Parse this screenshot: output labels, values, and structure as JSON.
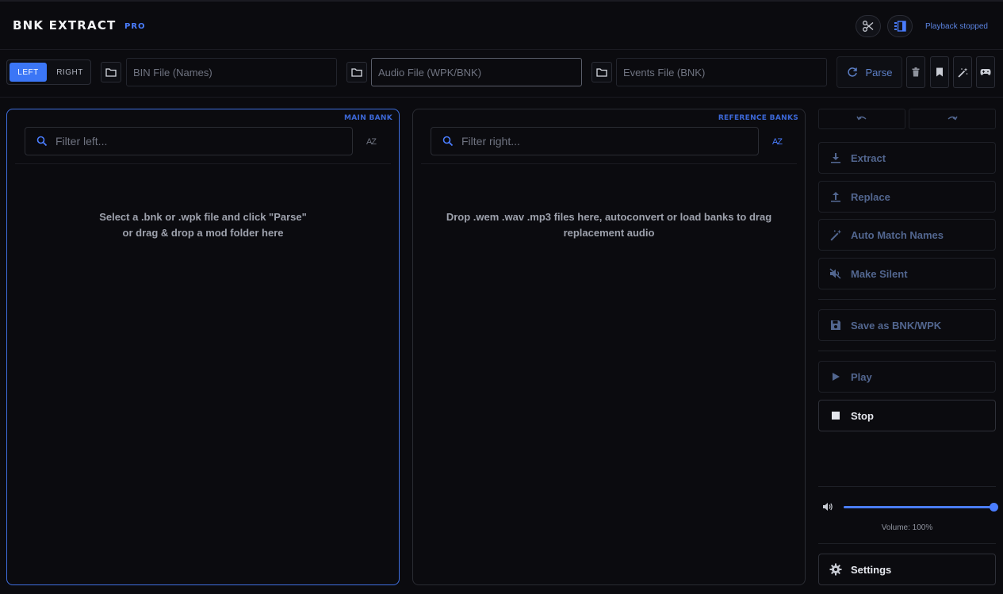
{
  "header": {
    "title": "BNK EXTRACT",
    "badge": "PRO",
    "playback_status": "Playback stopped",
    "icons": [
      "scissors-icon",
      "panel-layout-icon"
    ]
  },
  "toolbar": {
    "side_left": "LEFT",
    "side_right": "RIGHT",
    "bin_placeholder": "BIN File (Names)",
    "audio_placeholder": "Audio File (WPK/BNK)",
    "events_placeholder": "Events File (BNK)",
    "parse_label": "Parse",
    "tool_icons": [
      "trash-icon",
      "bookmark-icon",
      "magic-wand-icon",
      "gamepad-icon"
    ]
  },
  "left_panel": {
    "tag": "MAIN BANK",
    "filter_placeholder": "Filter left...",
    "sort_label": "AZ",
    "message_line1": "Select a .bnk or .wpk file and click \"Parse\"",
    "message_line2": "or drag & drop a mod folder here"
  },
  "right_panel": {
    "tag": "REFERENCE BANKS",
    "filter_placeholder": "Filter right...",
    "sort_label": "AZ",
    "message_line1": "Drop .wem .wav .mp3 files here, autoconvert or load banks to drag",
    "message_line2": "replacement audio"
  },
  "sidebar": {
    "extract": "Extract",
    "replace": "Replace",
    "auto_match": "Auto Match Names",
    "make_silent": "Make Silent",
    "save": "Save as BNK/WPK",
    "play": "Play",
    "stop": "Stop",
    "volume_label": "Volume: 100%",
    "volume_value": 1.0,
    "settings": "Settings"
  },
  "colors": {
    "accent": "#4a7dff",
    "background": "#0b0b0f",
    "disabled_text": "#52668f"
  }
}
